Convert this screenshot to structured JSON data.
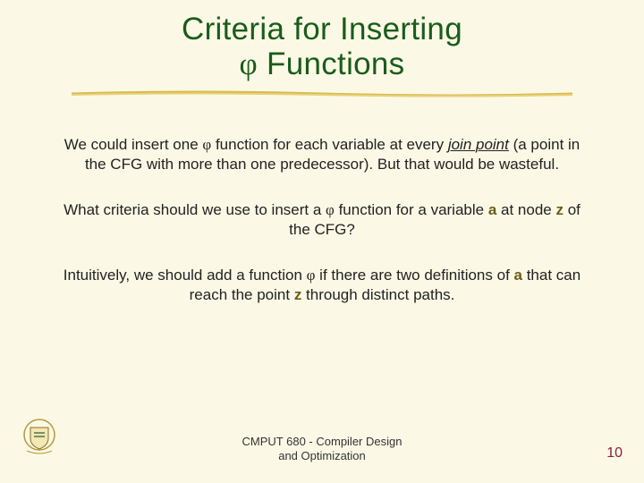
{
  "title": {
    "line1": "Criteria for Inserting",
    "line2_prefix": "",
    "phi": "φ",
    "line2_suffix": " Functions"
  },
  "body": {
    "p1": {
      "t1": "We could insert one ",
      "phi": "φ",
      "t2": " function for each variable at every ",
      "join_point": "join point",
      "t3": " (a point in the CFG with more than one predecessor). But that would be wasteful."
    },
    "p2": {
      "t1": "What criteria should we use to insert a ",
      "phi": "φ",
      "t2": " function for a variable ",
      "a": "a",
      "t3": " at node ",
      "z": "z",
      "t4": " of the CFG?"
    },
    "p3": {
      "t1": "Intuitively, we should add a function ",
      "phi": "φ",
      "t2": " if there are two definitions of ",
      "a": "a",
      "t3": " that can reach the point ",
      "z": "z",
      "t4": " through distinct paths."
    }
  },
  "footer": {
    "line1": "CMPUT 680 - Compiler Design",
    "line2": "and Optimization"
  },
  "page_number": "10"
}
